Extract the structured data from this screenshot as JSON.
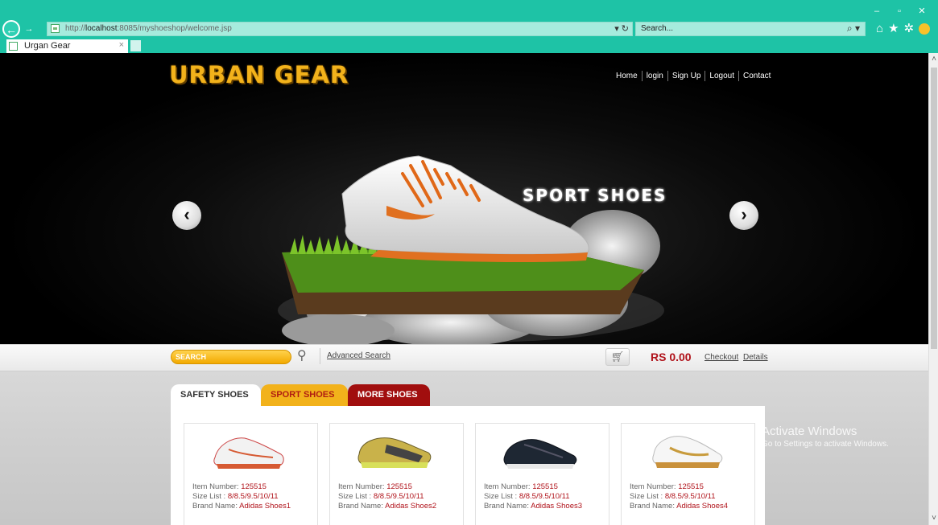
{
  "browser": {
    "url_prefix": "http://",
    "url_host": "localhost",
    "url_rest": ":8085/myshoeshop/welcome.jsp",
    "search_placeholder": "Search...",
    "tab_title": "Urgan Gear",
    "tab_close": "×",
    "window_controls": [
      "–",
      "▫",
      "✕"
    ]
  },
  "site": {
    "logo": "URBAN GEAR",
    "nav": [
      "Home",
      "login",
      "Sign Up",
      "Logout",
      "Contact"
    ]
  },
  "slider": {
    "caption": "SPORT SHOES"
  },
  "toolbar": {
    "search_label": "SEARCH",
    "advanced_search": "Advanced Search",
    "cart_total": "RS 0.00",
    "checkout": "Checkout",
    "details": "Details"
  },
  "tabs": [
    "SAFETY SHOES",
    "SPORT SHOES",
    "MORE SHOES"
  ],
  "products": [
    {
      "item_label": "Item Number:",
      "item_number": "125515",
      "size_label": "Size List :",
      "sizes": "8/8.5/9.5/10/11",
      "brand_label": "Brand Name:",
      "brand": "Adidas Shoes1"
    },
    {
      "item_label": "Item Number:",
      "item_number": "125515",
      "size_label": "Size List :",
      "sizes": "8/8.5/9.5/10/11",
      "brand_label": "Brand Name:",
      "brand": "Adidas Shoes2"
    },
    {
      "item_label": "Item Number:",
      "item_number": "125515",
      "size_label": "Size List :",
      "sizes": "8/8.5/9.5/10/11",
      "brand_label": "Brand Name:",
      "brand": "Adidas Shoes3"
    },
    {
      "item_label": "Item Number:",
      "item_number": "125515",
      "size_label": "Size List :",
      "sizes": "8/8.5/9.5/10/11",
      "brand_label": "Brand Name:",
      "brand": "Adidas Shoes4"
    }
  ],
  "watermark": {
    "title": "Activate Windows",
    "subtitle": "Go to Settings to activate Windows."
  },
  "colors": {
    "chrome": "#1ec3a6",
    "brand_gold": "#f2b21b",
    "brand_red": "#a10e0e",
    "price_red": "#b0121a"
  }
}
